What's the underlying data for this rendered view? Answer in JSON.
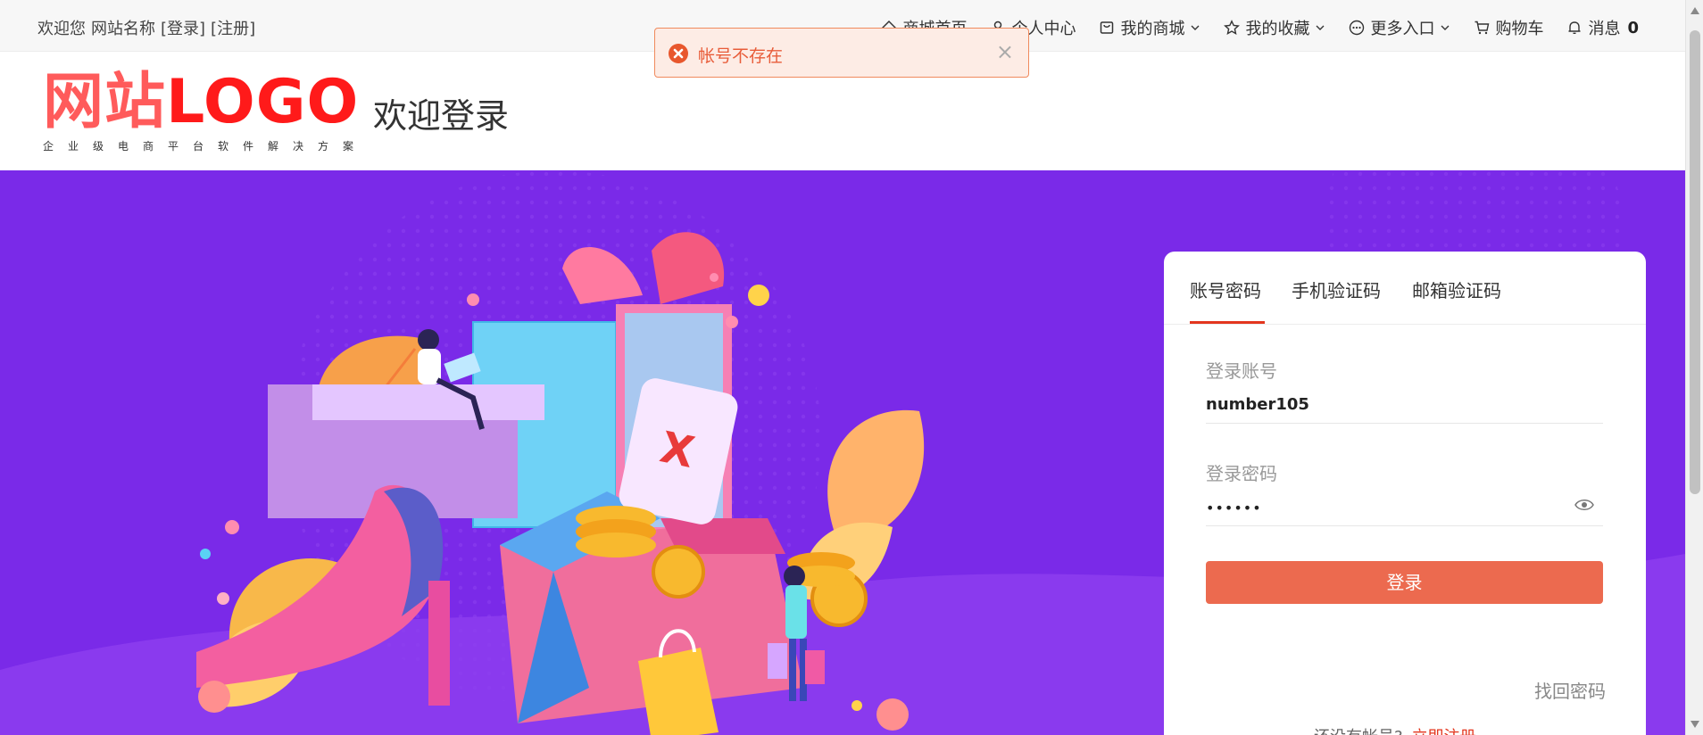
{
  "topbar": {
    "welcome": "欢迎您",
    "site_name": "网站名称",
    "login_link": "[登录]",
    "register_link": "[注册]"
  },
  "nav": {
    "home": "商城首页",
    "user_center": "个人中心",
    "my_mall": "我的商城",
    "favorites": "我的收藏",
    "more": "更多入口",
    "cart": "购物车",
    "messages": "消息",
    "message_count": "0"
  },
  "header": {
    "logo_cn": "网站",
    "logo_en": "LOGO",
    "logo_sub": "企业级电商平台软件解决方案",
    "title": "欢迎登录"
  },
  "toast": {
    "message": "帐号不存在",
    "close": "×"
  },
  "login": {
    "tabs": [
      "账号密码",
      "手机验证码",
      "邮箱验证码"
    ],
    "account_label": "登录账号",
    "account_value": "number105",
    "password_label": "登录密码",
    "password_value": "••••••",
    "submit": "登录",
    "forgot": "找回密码",
    "no_account": "还没有帐号?",
    "register_now": "立即注册"
  },
  "colors": {
    "banner": "#7a2ae8",
    "accent": "#e3361e",
    "button": "#ec6a4f",
    "logo_red": "#ff1a1a"
  }
}
